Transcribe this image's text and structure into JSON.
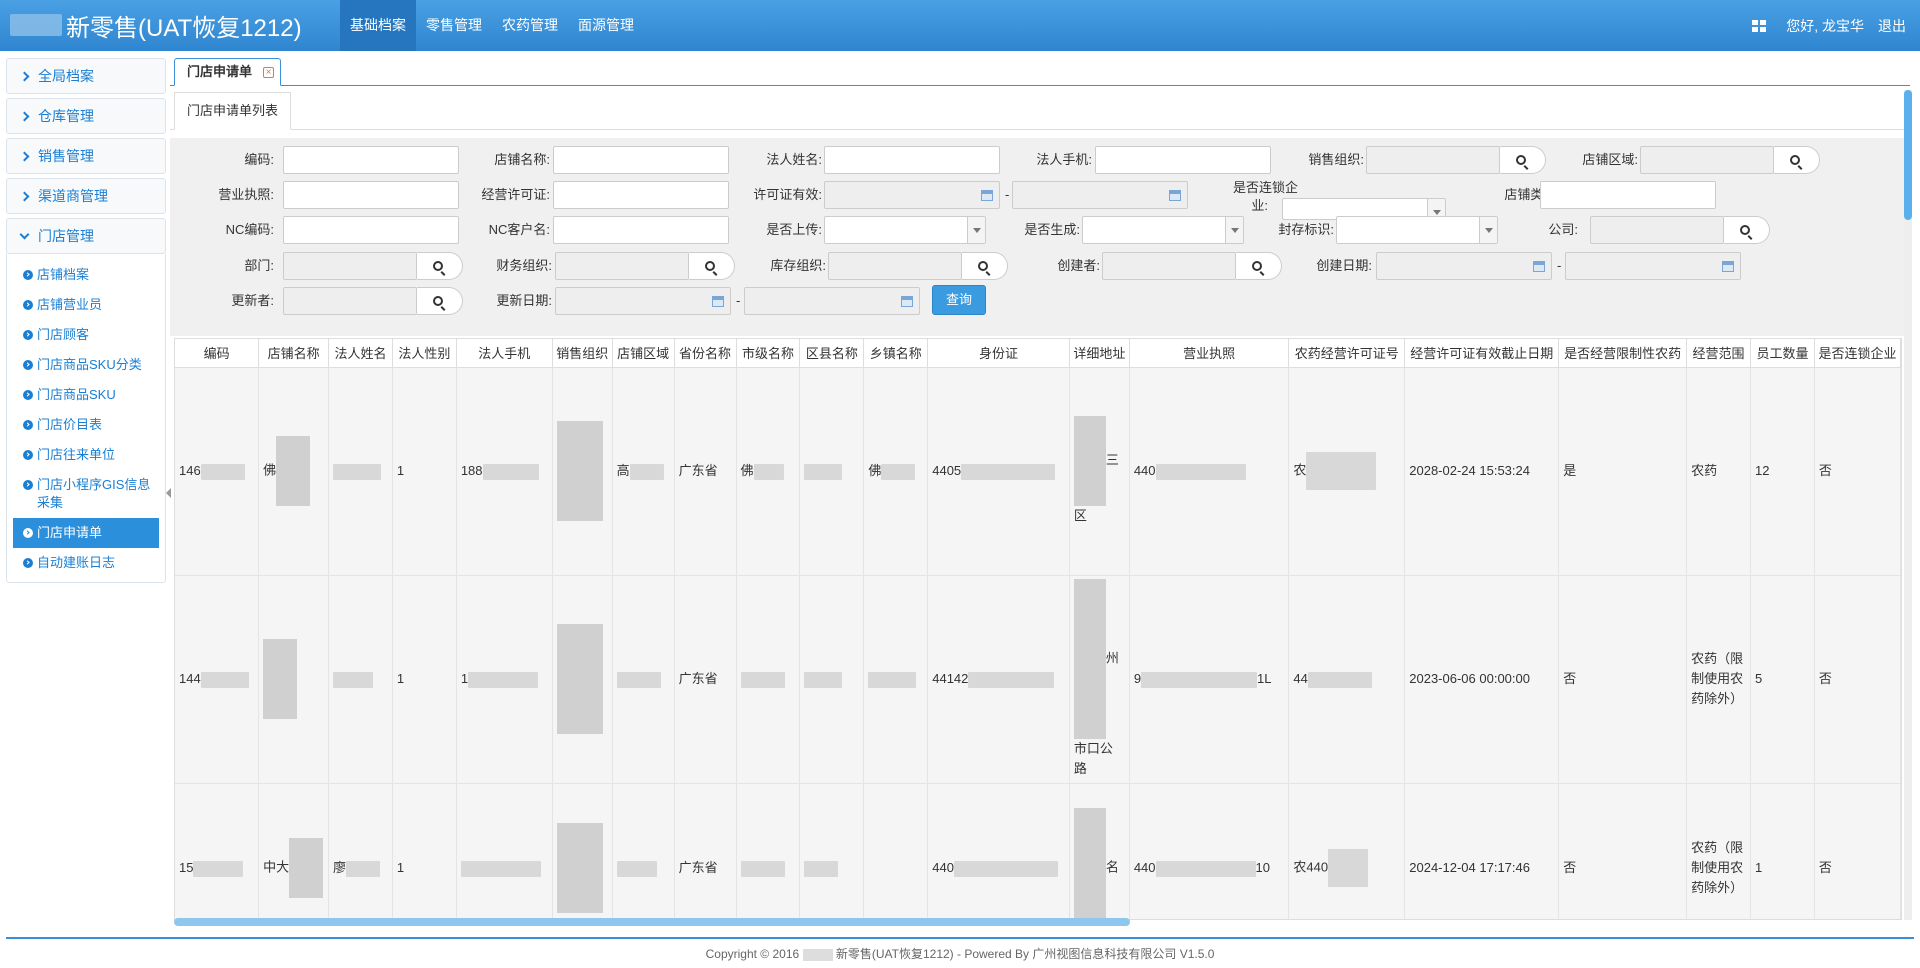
{
  "app": {
    "title": "新零售(UAT恢复1212)"
  },
  "topnav": [
    {
      "label": "基础档案",
      "active": true
    },
    {
      "label": "零售管理"
    },
    {
      "label": "农药管理"
    },
    {
      "label": "面源管理"
    }
  ],
  "user": {
    "greeting": "您好, 龙宝华",
    "logout": "退出"
  },
  "sidebar": {
    "groups": [
      "全局档案",
      "仓库管理",
      "销售管理",
      "渠道商管理"
    ],
    "open_group": "门店管理",
    "items": [
      "店铺档案",
      "店铺营业员",
      "门店顾客",
      "门店商品SKU分类",
      "门店商品SKU",
      "门店价目表",
      "门店往来单位",
      "门店小程序GIS信息采集",
      "门店申请单",
      "自动建账日志"
    ],
    "active_item": "门店申请单"
  },
  "tab": {
    "label": "门店申请单",
    "close": "×"
  },
  "subtab": {
    "label": "门店申请单列表"
  },
  "filters": {
    "code": "编码:",
    "store_name": "店铺名称:",
    "legal_name": "法人姓名:",
    "legal_phone": "法人手机:",
    "sales_org": "销售组织:",
    "store_area": "店铺区域:",
    "biz_license": "营业执照:",
    "op_license": "经营许可证:",
    "license_valid": "许可证有效:",
    "is_chain_1": "是否连锁企",
    "is_chain_2": "业:",
    "store_type": "店铺类型:",
    "nc_code": "NC编码:",
    "nc_customer": "NC客户名:",
    "is_uploaded": "是否上传:",
    "is_generated": "是否生成:",
    "seal_flag": "封存标识:",
    "company": "公司:",
    "dept": "部门:",
    "finance_org": "财务组织:",
    "stock_org": "库存组织:",
    "creator": "创建者:",
    "create_date": "创建日期:",
    "updater": "更新者:",
    "update_date": "更新日期:",
    "dash": "-",
    "query": "查询"
  },
  "table": {
    "columns": [
      "编码",
      "店铺名称",
      "法人姓名",
      "法人性别",
      "法人手机",
      "销售组织",
      "店铺区域",
      "省份名称",
      "市级名称",
      "区县名称",
      "乡镇名称",
      "身份证",
      "详细地址",
      "营业执照",
      "农药经营许可证号",
      "经营许可证有效截止日期",
      "是否经营限制性农药",
      "经营范围",
      "员工数量",
      "是否连锁企业"
    ],
    "rows": [
      {
        "code": "146",
        "name": "佛",
        "legal": "",
        "gender": "1",
        "phone": "188",
        "org": "",
        "area": "高",
        "province": "广东省",
        "city": "佛",
        "district": "",
        "town": "佛",
        "idcard": "4405",
        "address": "三区",
        "license": "440",
        "permit": "农",
        "expiry": "2028-02-24 15:53:24",
        "restricted": "是",
        "scope": "农药",
        "staff": "12",
        "chain": "否"
      },
      {
        "code": "144",
        "name": "",
        "legal": "",
        "gender": "1",
        "phone": "1",
        "org": "",
        "area": "",
        "province": "广东省",
        "city": "",
        "district": "",
        "town": "",
        "idcard": "44142",
        "address": "州市口公路",
        "license": "9",
        "permit": "44",
        "expiry": "2023-06-06 00:00:00",
        "restricted": "否",
        "scope": "农药（限制使用农药除外）",
        "staff": "5",
        "chain": "否"
      },
      {
        "code": "15",
        "name": "中大",
        "legal": "廖",
        "gender": "1",
        "phone": "",
        "org": "",
        "area": "",
        "province": "广东省",
        "city": "",
        "district": "",
        "town": "",
        "idcard": "440",
        "address": "名",
        "license": "440",
        "permit": "农440",
        "expiry": "2024-12-04 17:17:46",
        "restricted": "否",
        "scope": "农药（限制使用农药除外）",
        "staff": "1",
        "chain": "否"
      }
    ]
  },
  "footer": {
    "text": "Copyright © 2016",
    "text2": "新零售(UAT恢复1212) - Powered By 广州视图信息科技有限公司 V1.5.0"
  }
}
